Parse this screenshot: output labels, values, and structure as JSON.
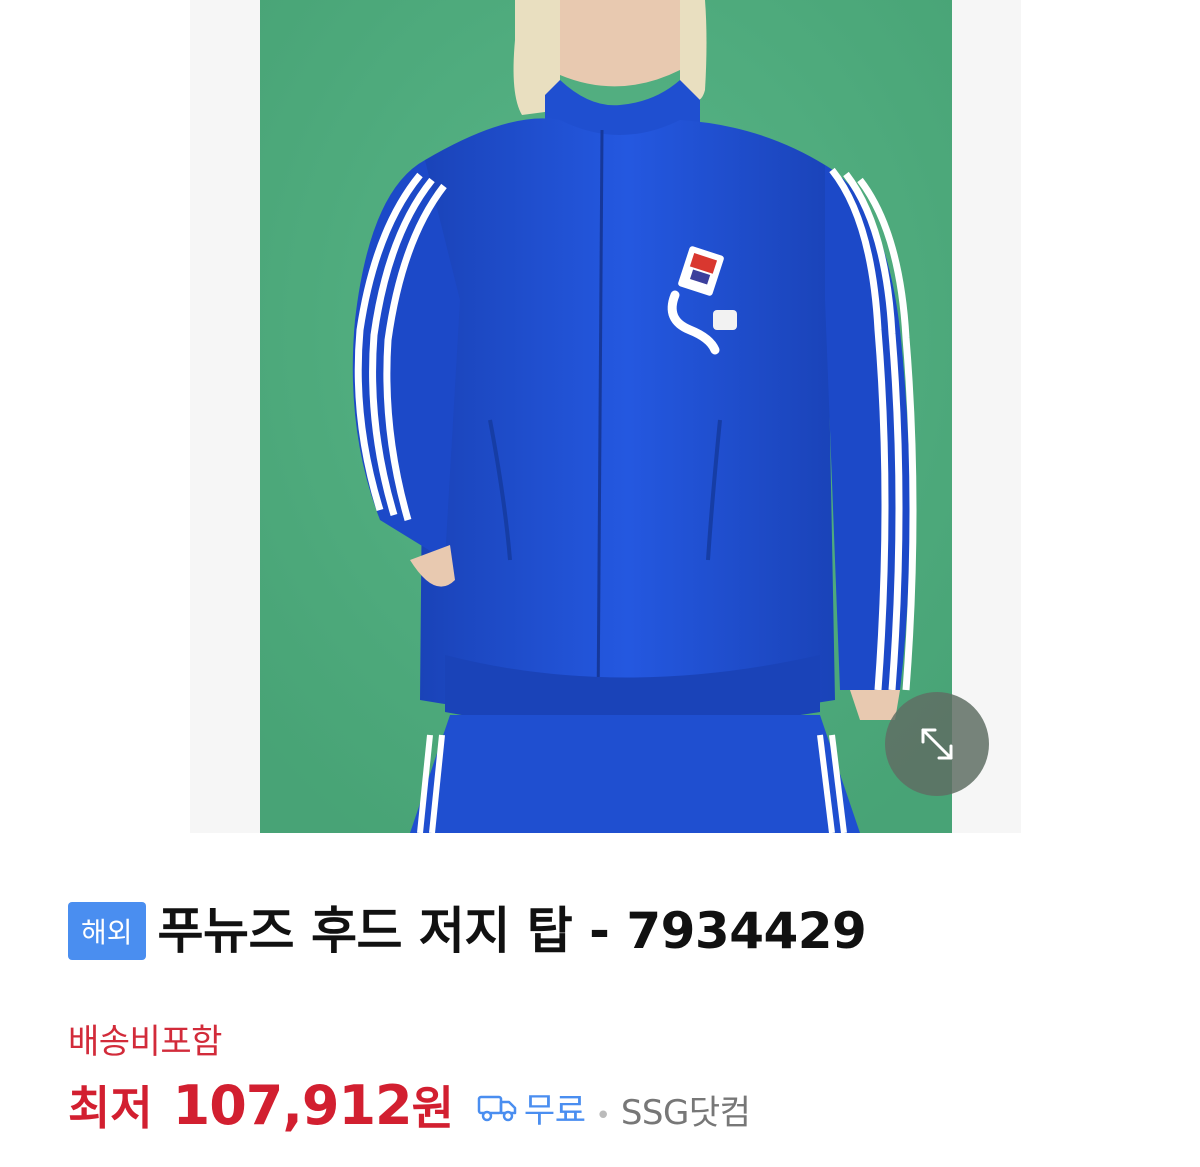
{
  "product": {
    "badge": "해외",
    "title": "푸뉴즈 후드 저지 탑 - 7934429",
    "shipping_note": "배송비포함",
    "price_label": "최저",
    "price_value": "107,912",
    "price_unit": "원",
    "delivery_label": "무료",
    "separator": "•",
    "seller": "SSG닷컴"
  },
  "icons": {
    "zoom": "expand-diagonal-icon",
    "delivery": "delivery-truck-icon"
  },
  "colors": {
    "price_red": "#d21f30",
    "shipping_red": "#d22b3a",
    "badge_blue": "#4a8ef0",
    "photo_background_green": "#4fae7f",
    "jacket_blue": "#1f4fd0"
  }
}
